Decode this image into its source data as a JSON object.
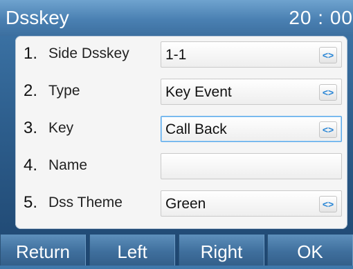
{
  "header": {
    "title": "Dsskey",
    "time": "20 : 00"
  },
  "rows": [
    {
      "number": "1.",
      "label": "Side Dsskey",
      "value": "1-1",
      "has_selector": true,
      "active": false
    },
    {
      "number": "2.",
      "label": "Type",
      "value": "Key Event",
      "has_selector": true,
      "active": false
    },
    {
      "number": "3.",
      "label": "Key",
      "value": "Call Back",
      "has_selector": true,
      "active": true
    },
    {
      "number": "4.",
      "label": "Name",
      "value": "",
      "has_selector": false,
      "active": false
    },
    {
      "number": "5.",
      "label": "Dss Theme",
      "value": "Green",
      "has_selector": true,
      "active": false
    }
  ],
  "selector_glyph": "<>",
  "softkeys": {
    "return": "Return",
    "left": "Left",
    "right": "Right",
    "ok": "OK"
  },
  "colors": {
    "accent": "#2a86d6",
    "focus_border": "#5aa7e8",
    "title_bar": "#4a80b2",
    "background": "#2e5f8e"
  }
}
